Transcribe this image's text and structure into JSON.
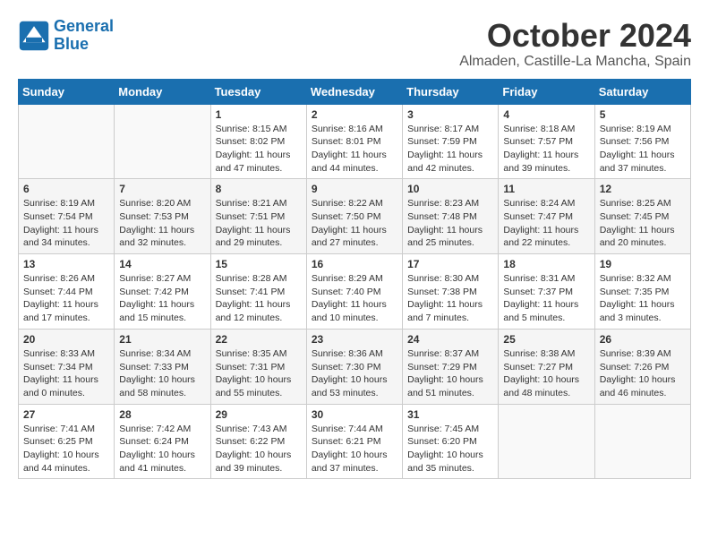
{
  "header": {
    "logo_line1": "General",
    "logo_line2": "Blue",
    "month": "October 2024",
    "location": "Almaden, Castille-La Mancha, Spain"
  },
  "days_of_week": [
    "Sunday",
    "Monday",
    "Tuesday",
    "Wednesday",
    "Thursday",
    "Friday",
    "Saturday"
  ],
  "weeks": [
    [
      {
        "day": "",
        "info": ""
      },
      {
        "day": "",
        "info": ""
      },
      {
        "day": "1",
        "info": "Sunrise: 8:15 AM\nSunset: 8:02 PM\nDaylight: 11 hours and 47 minutes."
      },
      {
        "day": "2",
        "info": "Sunrise: 8:16 AM\nSunset: 8:01 PM\nDaylight: 11 hours and 44 minutes."
      },
      {
        "day": "3",
        "info": "Sunrise: 8:17 AM\nSunset: 7:59 PM\nDaylight: 11 hours and 42 minutes."
      },
      {
        "day": "4",
        "info": "Sunrise: 8:18 AM\nSunset: 7:57 PM\nDaylight: 11 hours and 39 minutes."
      },
      {
        "day": "5",
        "info": "Sunrise: 8:19 AM\nSunset: 7:56 PM\nDaylight: 11 hours and 37 minutes."
      }
    ],
    [
      {
        "day": "6",
        "info": "Sunrise: 8:19 AM\nSunset: 7:54 PM\nDaylight: 11 hours and 34 minutes."
      },
      {
        "day": "7",
        "info": "Sunrise: 8:20 AM\nSunset: 7:53 PM\nDaylight: 11 hours and 32 minutes."
      },
      {
        "day": "8",
        "info": "Sunrise: 8:21 AM\nSunset: 7:51 PM\nDaylight: 11 hours and 29 minutes."
      },
      {
        "day": "9",
        "info": "Sunrise: 8:22 AM\nSunset: 7:50 PM\nDaylight: 11 hours and 27 minutes."
      },
      {
        "day": "10",
        "info": "Sunrise: 8:23 AM\nSunset: 7:48 PM\nDaylight: 11 hours and 25 minutes."
      },
      {
        "day": "11",
        "info": "Sunrise: 8:24 AM\nSunset: 7:47 PM\nDaylight: 11 hours and 22 minutes."
      },
      {
        "day": "12",
        "info": "Sunrise: 8:25 AM\nSunset: 7:45 PM\nDaylight: 11 hours and 20 minutes."
      }
    ],
    [
      {
        "day": "13",
        "info": "Sunrise: 8:26 AM\nSunset: 7:44 PM\nDaylight: 11 hours and 17 minutes."
      },
      {
        "day": "14",
        "info": "Sunrise: 8:27 AM\nSunset: 7:42 PM\nDaylight: 11 hours and 15 minutes."
      },
      {
        "day": "15",
        "info": "Sunrise: 8:28 AM\nSunset: 7:41 PM\nDaylight: 11 hours and 12 minutes."
      },
      {
        "day": "16",
        "info": "Sunrise: 8:29 AM\nSunset: 7:40 PM\nDaylight: 11 hours and 10 minutes."
      },
      {
        "day": "17",
        "info": "Sunrise: 8:30 AM\nSunset: 7:38 PM\nDaylight: 11 hours and 7 minutes."
      },
      {
        "day": "18",
        "info": "Sunrise: 8:31 AM\nSunset: 7:37 PM\nDaylight: 11 hours and 5 minutes."
      },
      {
        "day": "19",
        "info": "Sunrise: 8:32 AM\nSunset: 7:35 PM\nDaylight: 11 hours and 3 minutes."
      }
    ],
    [
      {
        "day": "20",
        "info": "Sunrise: 8:33 AM\nSunset: 7:34 PM\nDaylight: 11 hours and 0 minutes."
      },
      {
        "day": "21",
        "info": "Sunrise: 8:34 AM\nSunset: 7:33 PM\nDaylight: 10 hours and 58 minutes."
      },
      {
        "day": "22",
        "info": "Sunrise: 8:35 AM\nSunset: 7:31 PM\nDaylight: 10 hours and 55 minutes."
      },
      {
        "day": "23",
        "info": "Sunrise: 8:36 AM\nSunset: 7:30 PM\nDaylight: 10 hours and 53 minutes."
      },
      {
        "day": "24",
        "info": "Sunrise: 8:37 AM\nSunset: 7:29 PM\nDaylight: 10 hours and 51 minutes."
      },
      {
        "day": "25",
        "info": "Sunrise: 8:38 AM\nSunset: 7:27 PM\nDaylight: 10 hours and 48 minutes."
      },
      {
        "day": "26",
        "info": "Sunrise: 8:39 AM\nSunset: 7:26 PM\nDaylight: 10 hours and 46 minutes."
      }
    ],
    [
      {
        "day": "27",
        "info": "Sunrise: 7:41 AM\nSunset: 6:25 PM\nDaylight: 10 hours and 44 minutes."
      },
      {
        "day": "28",
        "info": "Sunrise: 7:42 AM\nSunset: 6:24 PM\nDaylight: 10 hours and 41 minutes."
      },
      {
        "day": "29",
        "info": "Sunrise: 7:43 AM\nSunset: 6:22 PM\nDaylight: 10 hours and 39 minutes."
      },
      {
        "day": "30",
        "info": "Sunrise: 7:44 AM\nSunset: 6:21 PM\nDaylight: 10 hours and 37 minutes."
      },
      {
        "day": "31",
        "info": "Sunrise: 7:45 AM\nSunset: 6:20 PM\nDaylight: 10 hours and 35 minutes."
      },
      {
        "day": "",
        "info": ""
      },
      {
        "day": "",
        "info": ""
      }
    ]
  ]
}
